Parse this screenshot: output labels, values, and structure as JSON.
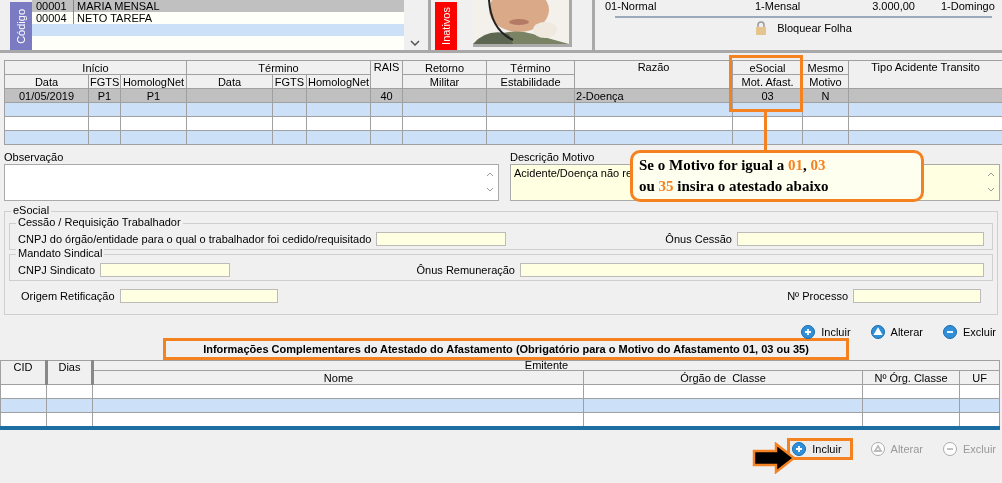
{
  "employees": {
    "tab_label": "Código",
    "inactive_tab_label": "Inativos",
    "rows": [
      {
        "code": "00001",
        "name": "MARIA MENSAL",
        "selected": true
      },
      {
        "code": "00004",
        "name": "NETO TAREFA",
        "selected": false
      }
    ]
  },
  "contract": {
    "values": [
      "01-Normal",
      "1-Mensal",
      "3.000,00",
      "1-Domingo"
    ],
    "lock_button": "Bloquear Folha"
  },
  "absence_grid": {
    "groups": [
      {
        "label": "Início",
        "columns": [
          "Data",
          "FGTS",
          "HomologNet"
        ]
      },
      {
        "label": "Término",
        "columns": [
          "Data",
          "FGTS",
          "HomologNet"
        ]
      },
      {
        "label": "RAIS"
      },
      {
        "label": "Retorno",
        "columns": [
          "Militar"
        ]
      },
      {
        "label": "Término",
        "columns": [
          "Estabilidade"
        ]
      },
      {
        "label": "Razão",
        "kind": "text"
      },
      {
        "label": "eSocial",
        "columns": [
          "Mot. Afast."
        ]
      },
      {
        "label": "Mesmo",
        "columns": [
          "Motivo"
        ]
      },
      {
        "label": "Tipo Acidente Transito"
      }
    ],
    "rows": [
      {
        "selected": true,
        "cells": [
          "01/05/2019",
          "P1",
          "P1",
          null,
          null,
          null,
          "40",
          null,
          null,
          "2-Doença",
          "03",
          "N",
          null
        ]
      }
    ]
  },
  "observacao": {
    "label": "Observação"
  },
  "descricao_motivo": {
    "label": "Descrição Motivo",
    "value": "Acidente/Doença não re"
  },
  "callout": {
    "lines": [
      [
        {
          "text": "Se o Motivo for igual a ",
          "highlight": false
        },
        {
          "text": "01",
          "highlight": true
        },
        {
          "text": ", ",
          "highlight": false
        },
        {
          "text": "03",
          "highlight": true
        }
      ],
      [
        {
          "text": "ou ",
          "highlight": false
        },
        {
          "text": "35",
          "highlight": true
        },
        {
          "text": " insira o atestado abaixo",
          "highlight": false
        }
      ]
    ]
  },
  "esocial": {
    "title": "eSocial",
    "cessao": {
      "title": "Cessão / Requisição Trabalhador",
      "cnpj_label": "CNPJ do órgão/entidade para o qual o trabalhador foi cedido/requisitado",
      "onus_label": "Ônus Cessão"
    },
    "mandato": {
      "title": "Mandato Sindical",
      "cnpj_label": "CNPJ Sindicato",
      "onus_label": "Ônus Remuneração"
    },
    "origem_label": "Origem Retificação",
    "processo_label": "Nº Processo"
  },
  "top_actions": [
    {
      "kind": "add",
      "label": "Incluir",
      "disabled": false
    },
    {
      "kind": "edit",
      "label": "Alterar",
      "disabled": false
    },
    {
      "kind": "delete",
      "label": "Excluir",
      "disabled": false
    }
  ],
  "atestado": {
    "title": "Informações Complementares do Atestado do Afastamento (Obrigatório para o Motivo do Afastamento 01, 03 ou 35)",
    "columns": [
      {
        "label": "CID"
      },
      {
        "label": "Dias"
      },
      {
        "label": "Emitente",
        "columns": [
          "Nome",
          "Órgão de  Classe",
          "Nº Órg. Classe",
          "UF"
        ]
      }
    ]
  },
  "bottom_actions": [
    {
      "kind": "add",
      "label": "Incluir",
      "disabled": false,
      "highlighted": true
    },
    {
      "kind": "edit",
      "label": "Alterar",
      "disabled": true,
      "highlighted": false
    },
    {
      "kind": "delete",
      "label": "Excluir",
      "disabled": true,
      "highlighted": false
    }
  ]
}
